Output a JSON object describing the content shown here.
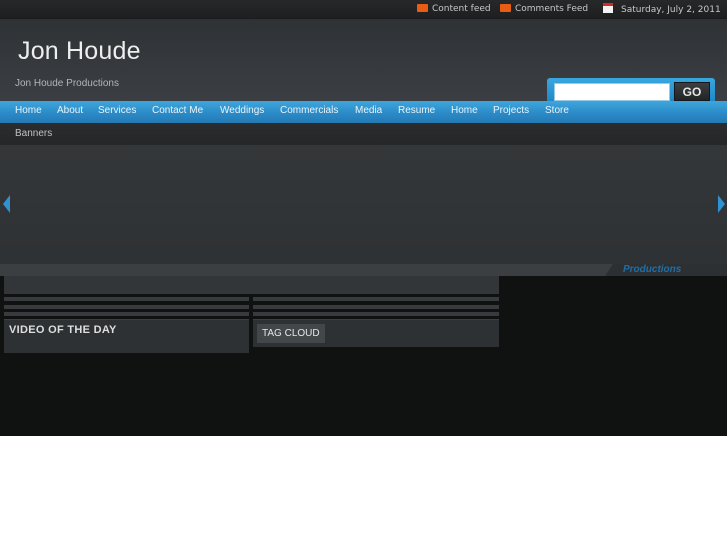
{
  "topbar": {
    "content_feed": "Content feed",
    "comments_feed": "Comments Feed",
    "date": "Saturday, July 2, 2011",
    "icons": [
      "rss-icon",
      "rss-icon",
      "calendar-icon"
    ],
    "feed_color": "#e85d12"
  },
  "header": {
    "title": "Jon Houde",
    "tagline": "Jon Houde Productions"
  },
  "search": {
    "placeholder": "",
    "value": "",
    "button_label": "GO"
  },
  "nav": {
    "items": [
      {
        "label": "Home"
      },
      {
        "label": "About"
      },
      {
        "label": "Services"
      },
      {
        "label": "Contact Me"
      },
      {
        "label": "Weddings"
      },
      {
        "label": "Commercials"
      },
      {
        "label": "Media"
      },
      {
        "label": "Resume"
      },
      {
        "label": "Home"
      },
      {
        "label": "Projects"
      },
      {
        "label": "Store"
      }
    ],
    "accent_color": "#2b8bc8"
  },
  "subnav": {
    "items": [
      {
        "label": "Banners"
      }
    ]
  },
  "slider": {
    "brand_text": "Productions"
  },
  "widgets": {
    "video_title": "VIDEO OF THE DAY",
    "tag_title": "TAG CLOUD"
  }
}
